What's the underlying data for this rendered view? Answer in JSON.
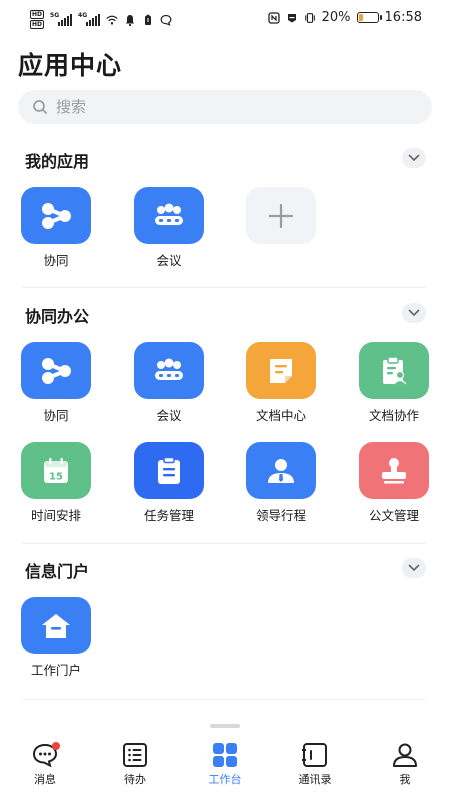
{
  "status_bar": {
    "network_labels": [
      "5G",
      "4G"
    ],
    "battery_percent": "20%",
    "battery_level": 0.2,
    "time": "16:58"
  },
  "page": {
    "title": "应用中心"
  },
  "search": {
    "placeholder": "搜索"
  },
  "my_apps": {
    "title": "我的应用",
    "items": [
      {
        "label": "协同",
        "icon": "collaboration-icon",
        "color": "#3b7ff5"
      },
      {
        "label": "会议",
        "icon": "meeting-icon",
        "color": "#3b7ff5"
      },
      {
        "label": "",
        "icon": "add-icon",
        "color": "#f2f3f6"
      }
    ]
  },
  "office": {
    "title": "协同办公",
    "items": [
      {
        "label": "协同",
        "icon": "collaboration-icon",
        "color": "#3b7ff5"
      },
      {
        "label": "会议",
        "icon": "meeting-icon",
        "color": "#3b7ff5"
      },
      {
        "label": "文档中心",
        "icon": "document-icon",
        "color": "#f4a63b"
      },
      {
        "label": "文档协作",
        "icon": "document-collab-icon",
        "color": "#5fc08a"
      },
      {
        "label": "时间安排",
        "icon": "calendar-icon",
        "color": "#5fc08a"
      },
      {
        "label": "任务管理",
        "icon": "task-icon",
        "color": "#2f6bf0"
      },
      {
        "label": "领导行程",
        "icon": "leader-schedule-icon",
        "color": "#3b7ff5"
      },
      {
        "label": "公文管理",
        "icon": "stamp-icon",
        "color": "#f07477"
      }
    ]
  },
  "portal": {
    "title": "信息门户",
    "items": [
      {
        "label": "工作门户",
        "icon": "home-portal-icon",
        "color": "#3b7ff5"
      }
    ]
  },
  "calendar_day": "15",
  "bottom_nav": {
    "items": [
      {
        "label": "消息",
        "icon": "message-icon",
        "active": false,
        "badge": true
      },
      {
        "label": "待办",
        "icon": "todo-icon",
        "active": false
      },
      {
        "label": "工作台",
        "icon": "workbench-icon",
        "active": true
      },
      {
        "label": "通讯录",
        "icon": "contacts-icon",
        "active": false
      },
      {
        "label": "我",
        "icon": "profile-icon",
        "active": false
      }
    ],
    "active_color": "#3b7ff5"
  }
}
